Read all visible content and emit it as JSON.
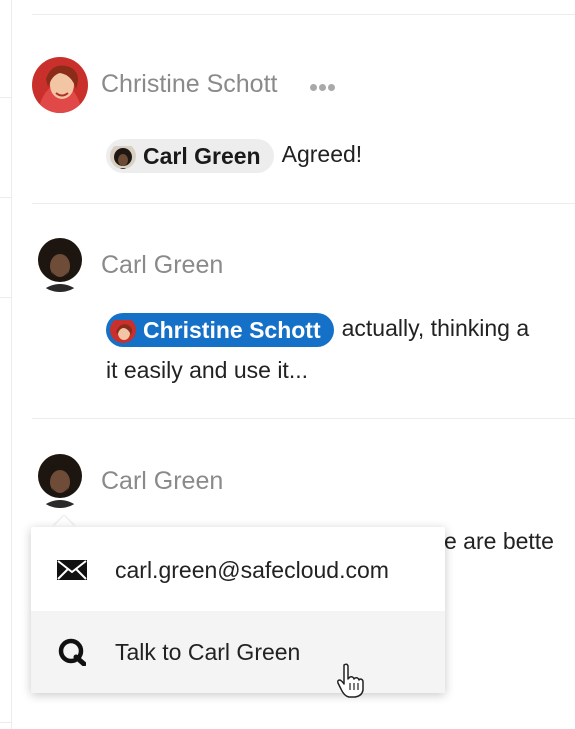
{
  "thread": {
    "messages": [
      {
        "author": "Christine Schott",
        "mention": "Carl Green",
        "text": "Agreed!"
      },
      {
        "author": "Carl Green",
        "mention": "Christine Schott",
        "text_line1": "actually, thinking a",
        "text_line2": "it easily and use it..."
      },
      {
        "author": "Carl Green",
        "partial_text": "e are bette"
      }
    ]
  },
  "contact_popup": {
    "items": [
      {
        "label": "carl.green@safecloud.com",
        "icon": "envelope-icon"
      },
      {
        "label": "Talk to Carl Green",
        "icon": "chat-icon"
      }
    ]
  },
  "colors": {
    "mention_blue": "#1570c7",
    "mention_gray": "#ededed",
    "author_gray": "#8a8a8a"
  }
}
